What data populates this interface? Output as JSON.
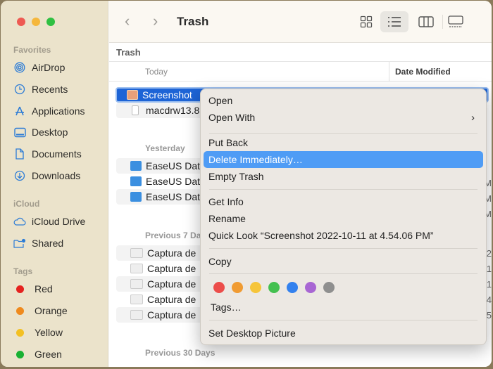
{
  "window": {
    "title": "Trash",
    "traffic_lights": {
      "close": "#ee5a52",
      "minimize": "#f5b73c",
      "zoom": "#2fc042"
    }
  },
  "sidebar": {
    "favorites_label": "Favorites",
    "favorites": [
      {
        "label": "AirDrop",
        "icon": "airdrop-icon"
      },
      {
        "label": "Recents",
        "icon": "clock-icon"
      },
      {
        "label": "Applications",
        "icon": "applications-icon"
      },
      {
        "label": "Desktop",
        "icon": "desktop-icon"
      },
      {
        "label": "Documents",
        "icon": "document-icon"
      },
      {
        "label": "Downloads",
        "icon": "download-icon"
      }
    ],
    "icloud_label": "iCloud",
    "icloud": [
      {
        "label": "iCloud Drive",
        "icon": "cloud-icon"
      },
      {
        "label": "Shared",
        "icon": "shared-folder-icon"
      }
    ],
    "tags_label": "Tags",
    "tags": [
      {
        "label": "Red",
        "color": "#e5221f"
      },
      {
        "label": "Orange",
        "color": "#ef8a1d"
      },
      {
        "label": "Yellow",
        "color": "#f3c022"
      },
      {
        "label": "Green",
        "color": "#19b133"
      }
    ]
  },
  "toolbar": {
    "back": "‹",
    "forward": "›",
    "views": [
      "icon-view",
      "list-view",
      "column-view",
      "gallery-view"
    ],
    "active_view": "list-view"
  },
  "pathbar": {
    "label": "Trash"
  },
  "columns": {
    "name_group": "Today",
    "date_modified": "Date Modified"
  },
  "groups": {
    "today": "Today",
    "yesterday": "Yesterday",
    "prev7": "Previous 7 Da",
    "prev30": "Previous 30 Days"
  },
  "files": {
    "today": [
      {
        "name": "Screenshot",
        "selected": true
      },
      {
        "name": "macdrw13.8"
      }
    ],
    "yesterday": [
      {
        "name": "EaseUS Dat",
        "date_fragment": "AM"
      },
      {
        "name": "EaseUS Dat",
        "date_fragment": "AM"
      },
      {
        "name": "EaseUS Dat",
        "date_fragment": "AM"
      }
    ],
    "prev7": [
      {
        "name": "Captura de",
        "date_fragment": "2"
      },
      {
        "name": "Captura de",
        "date_fragment": "1"
      },
      {
        "name": "Captura de",
        "date_fragment": "1"
      },
      {
        "name": "Captura de",
        "date_fragment": "4"
      },
      {
        "name": "Captura de",
        "date_fragment": "5"
      }
    ]
  },
  "context_menu": {
    "items": [
      {
        "label": "Open"
      },
      {
        "label": "Open With",
        "submenu": true
      },
      {
        "label": "Put Back"
      },
      {
        "label": "Delete Immediately…",
        "highlighted": true
      },
      {
        "label": "Empty Trash"
      },
      {
        "label": "Get Info"
      },
      {
        "label": "Rename"
      },
      {
        "label": "Quick Look “Screenshot 2022-10-11 at 4.54.06 PM”"
      },
      {
        "label": "Copy"
      },
      {
        "label": "Tags…"
      },
      {
        "label": "Set Desktop Picture"
      }
    ],
    "submenu_chevron": "›",
    "tag_colors": [
      {
        "name": "red",
        "hex": "#ec4d4a"
      },
      {
        "name": "orange",
        "hex": "#f09b32"
      },
      {
        "name": "yellow",
        "hex": "#f6c53a"
      },
      {
        "name": "green",
        "hex": "#44c050"
      },
      {
        "name": "blue",
        "hex": "#3381ee"
      },
      {
        "name": "purple",
        "hex": "#a866d3"
      },
      {
        "name": "gray",
        "hex": "#8f8f8f"
      }
    ]
  }
}
